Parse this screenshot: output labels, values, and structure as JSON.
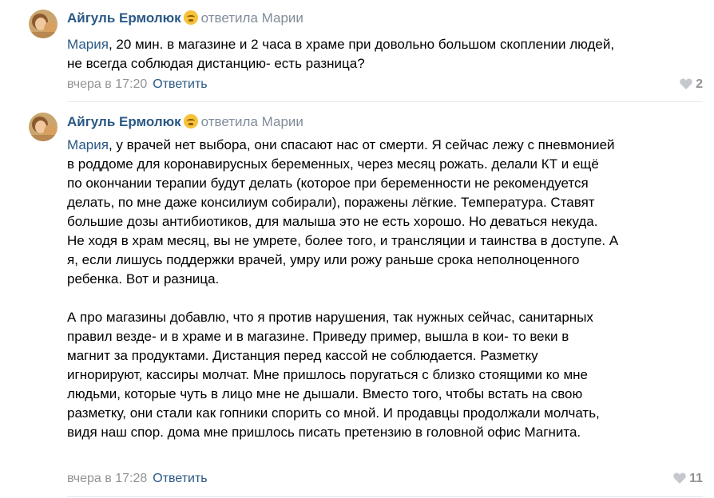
{
  "comments": [
    {
      "author": "Айгуль Ермолюк",
      "replied_to": "ответила Марии",
      "mention": "Мария",
      "text_lines": [
        ", 20 мин. в магазине и 2 часа в храме при довольно большом скоплении людей,",
        "не всегда соблюдая дистанцию- есть разница?"
      ],
      "date": "вчера в 17:20",
      "reply_label": "Ответить",
      "likes": "2",
      "emoji_icon": "face-emoji-icon"
    },
    {
      "author": "Айгуль Ермолюк",
      "replied_to": "ответила Марии",
      "mention": "Мария",
      "paragraph1_lines": [
        ", у врачей нет выбора, они спасают нас от смерти. Я сейчас лежу с пневмонией",
        "в роддоме для коронавирусных беременных, через месяц рожать. делали КТ и ещё",
        "по окончании терапии будут делать (которое при беременности не рекомендуется",
        "делать, по мне даже консилиум собирали), поражены лёгкие. Температура. Ставят",
        "большие дозы антибиотиков, для малыша это не есть хорошо. Но деваться некуда.",
        "Не ходя в храм месяц, вы не умрете, более того, и трансляции и таинства в доступе. А",
        "я, если лишусь поддержки врачей, умру или рожу раньше срока неполноценного",
        "ребенка. Вот и разница."
      ],
      "paragraph2_lines": [
        "А про магазины добавлю, что я против нарушения, так нужных сейчас, санитарных",
        "правил везде- и в храме и в магазине. Приведу пример, вышла в кои- то веки в",
        "магнит за продуктами. Дистанция перед кассой не соблюдается. Разметку",
        "игнорируют, кассиры молчат. Мне пришлось поругаться с близко стоящими ко мне",
        "людьми, которые чуть в лицо мне не дышали. Вместо того, чтобы встать на свою",
        "разметку, они стали как гопники спорить со мной. И продавцы продолжали молчать,",
        "видя наш спор. дома мне пришлось писать претензию в головной офис Магнита."
      ],
      "date": "вчера в 17:28",
      "reply_label": "Ответить",
      "likes": "11",
      "emoji_icon": "face-emoji-icon"
    }
  ],
  "colors": {
    "link": "#2a5885",
    "muted": "#818c99",
    "meta": "#939393",
    "divider": "#e7e8ec"
  }
}
